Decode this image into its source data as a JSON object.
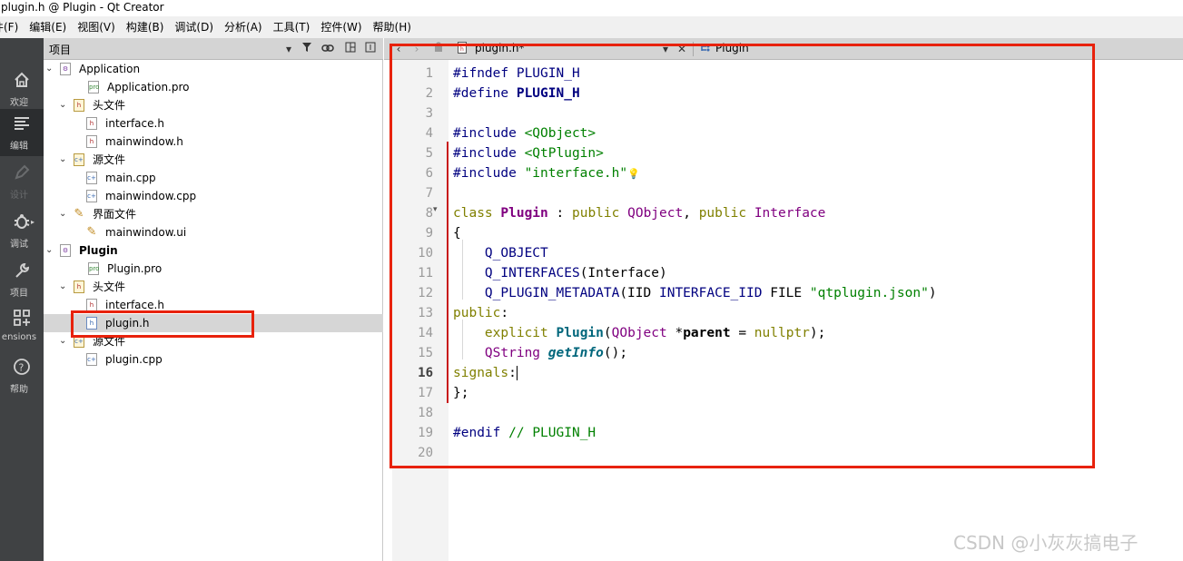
{
  "window": {
    "title": "plugin.h @ Plugin - Qt Creator"
  },
  "menu": [
    "件(F)",
    "编辑(E)",
    "视图(V)",
    "构建(B)",
    "调试(D)",
    "分析(A)",
    "工具(T)",
    "控件(W)",
    "帮助(H)"
  ],
  "modes": [
    {
      "label": "欢迎",
      "icon": "home-icon",
      "state": "normal"
    },
    {
      "label": "编辑",
      "icon": "edit-lines-icon",
      "state": "active"
    },
    {
      "label": "设计",
      "icon": "pen-icon",
      "state": "disabled"
    },
    {
      "label": "调试",
      "icon": "bug-icon",
      "state": "normal"
    },
    {
      "label": "项目",
      "icon": "wrench-icon",
      "state": "normal"
    },
    {
      "label": "ensions",
      "icon": "extensions-icon",
      "state": "normal"
    },
    {
      "label": "帮助",
      "icon": "help-icon",
      "state": "normal"
    }
  ],
  "project_panel": {
    "title": "项目",
    "tree": [
      {
        "label": "Application",
        "depth": 0,
        "kind": "project",
        "expanded": true,
        "bold": false
      },
      {
        "label": "Application.pro",
        "depth": 1,
        "kind": "pro"
      },
      {
        "label": "头文件",
        "depth": 1,
        "kind": "folder-h",
        "expanded": true
      },
      {
        "label": "interface.h",
        "depth": 2,
        "kind": "h"
      },
      {
        "label": "mainwindow.h",
        "depth": 2,
        "kind": "h"
      },
      {
        "label": "源文件",
        "depth": 1,
        "kind": "folder-cpp",
        "expanded": true
      },
      {
        "label": "main.cpp",
        "depth": 2,
        "kind": "cpp"
      },
      {
        "label": "mainwindow.cpp",
        "depth": 2,
        "kind": "cpp"
      },
      {
        "label": "界面文件",
        "depth": 1,
        "kind": "folder-ui",
        "expanded": true
      },
      {
        "label": "mainwindow.ui",
        "depth": 2,
        "kind": "ui"
      },
      {
        "label": "Plugin",
        "depth": 0,
        "kind": "project",
        "expanded": true,
        "bold": true
      },
      {
        "label": "Plugin.pro",
        "depth": 1,
        "kind": "pro"
      },
      {
        "label": "头文件",
        "depth": 1,
        "kind": "folder-h",
        "expanded": true
      },
      {
        "label": "interface.h",
        "depth": 2,
        "kind": "h"
      },
      {
        "label": "plugin.h",
        "depth": 2,
        "kind": "h",
        "selected": true
      },
      {
        "label": "源文件",
        "depth": 1,
        "kind": "folder-cpp",
        "expanded": true
      },
      {
        "label": "plugin.cpp",
        "depth": 2,
        "kind": "cpp"
      }
    ]
  },
  "editor": {
    "file_tab": "plugin.h*",
    "symbol": "Plugin",
    "current_line": 16,
    "line_numbers": [
      "1",
      "2",
      "3",
      "4",
      "5",
      "6",
      "7",
      "8",
      "9",
      "10",
      "11",
      "12",
      "13",
      "14",
      "15",
      "16",
      "17",
      "18",
      "19",
      "20"
    ]
  },
  "colors": {
    "annotation_red": "#e8220c",
    "modebar_bg": "#404244",
    "panel_header": "#d4d4d4"
  },
  "watermark": "CSDN @小灰灰搞电子"
}
